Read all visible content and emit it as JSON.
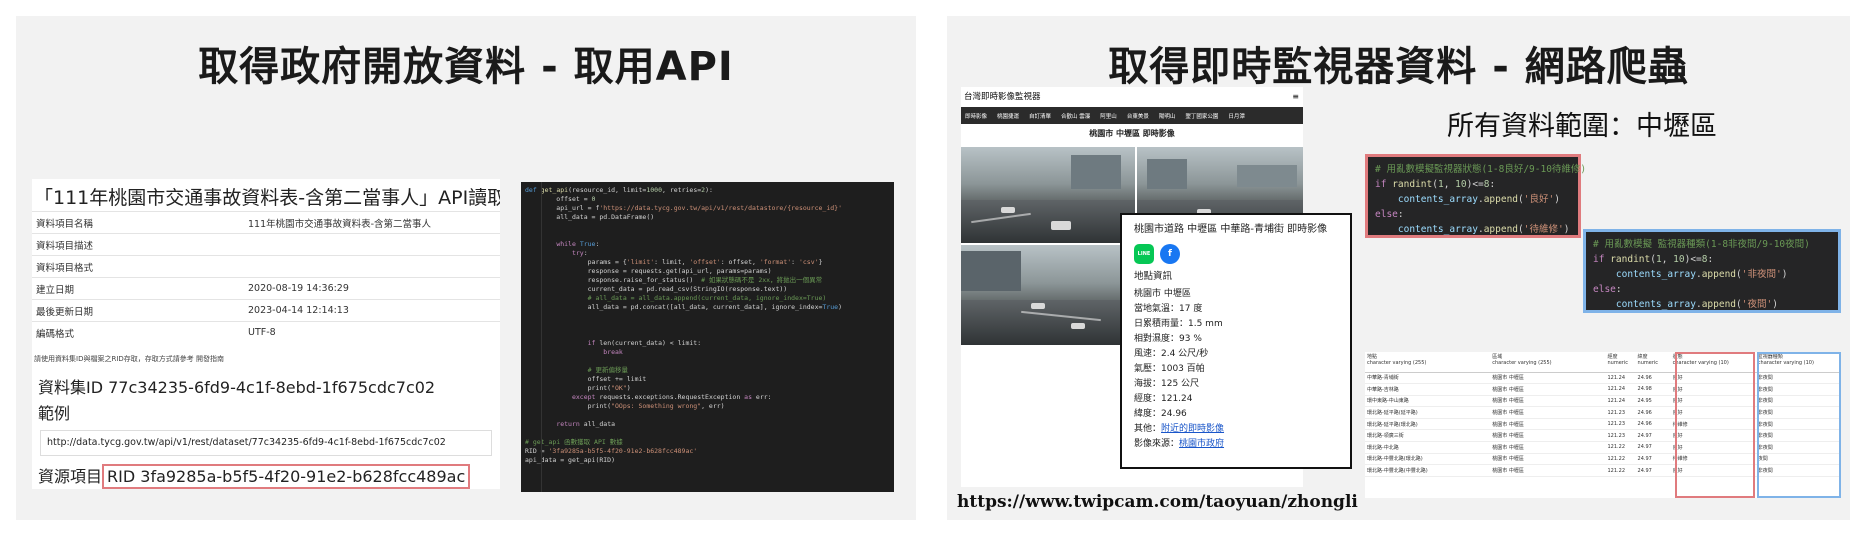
{
  "left": {
    "title": "取得政府開放資料 - 取用API",
    "api_heading": "「111年桃園市交通事故資料表-含第二當事人」API讀取",
    "meta_rows": [
      {
        "key": "資料項目名稱",
        "value": "111年桃園市交通事故資料表-含第二當事人"
      },
      {
        "key": "資料項目描述",
        "value": ""
      },
      {
        "key": "資料項目格式",
        "value": ""
      },
      {
        "key": "建立日期",
        "value": "2020-08-19 14:36:29"
      },
      {
        "key": "最後更新日期",
        "value": "2023-04-14 12:14:13"
      },
      {
        "key": "編碼格式",
        "value": "UTF-8"
      }
    ],
    "note": "請使用資料集ID與檔案之RID存取，存取方式請參考 開發指南",
    "dataset_id": "資料集ID 77c34235-6fd9-4c1f-8ebd-1f675cdc7c02",
    "example_label": "範例",
    "example_url": "http://data.tycg.gov.tw/api/v1/rest/dataset/77c34235-6fd9-4c1f-8ebd-1f675cdc7c02",
    "rid_label": "資源項目",
    "rid_value": "RID 3fa9285a-b5f5-4f20-91e2-b628fcc489ac"
  },
  "right": {
    "title": "取得即時監視器資料 - 網路爬蟲",
    "scope_label": "所有資料範圍：中壢區",
    "site_title": "台灣即時影像監視器",
    "menu_icon": "≡",
    "nav_items": [
      "即時影像",
      "桃園捷運",
      "自訂清單",
      "合歡山 雲瀑",
      "阿里山",
      "台東美景",
      "陽明山",
      "墾丁國家公園",
      "日月潭"
    ],
    "cam_heading": "桃園市 中壢區 即時影像",
    "popup": {
      "title": "桃園市道路 中壢區 中華路-青埔街 即時影像",
      "line_icon": "LINE",
      "facebook_icon": "f",
      "section": "地點資訊",
      "lines": [
        "桃園市 中壢區",
        "當地氣溫：17 度",
        "日累積雨量：1.5 mm",
        "相對濕度：93 %",
        "風速：2.4 公尺/秒",
        "氣壓：1003 百帕",
        "海拔：125 公尺",
        "經度：121.24",
        "緯度：24.96"
      ],
      "nearby_label": "其他：",
      "nearby_link": "附近的即時影像",
      "source_label": "影像來源：",
      "source_link": "桃園市政府"
    },
    "code1": {
      "comment": "# 用亂數模擬監視器狀態(1-8良好/9-10待維修)",
      "good": "'良好'",
      "repair": "'待維修'"
    },
    "code2": {
      "comment": "# 用亂數模擬 監視器種類(1-8非夜間/9-10夜間)",
      "nonnight": "'非夜間'",
      "night": "'夜間'"
    },
    "site_url": "https://www.twipcam.com/taoyuan/zhongli",
    "table": {
      "headers": [
        {
          "name": "地點",
          "type": "character varying (255)"
        },
        {
          "name": "區域",
          "type": "character varying (255)"
        },
        {
          "name": "經度",
          "type": "numeric"
        },
        {
          "name": "緯度",
          "type": "numeric"
        },
        {
          "name": "狀態",
          "type": "character varying (10)"
        },
        {
          "name": "監視器種類",
          "type": "character varying (10)"
        }
      ],
      "rows": [
        [
          "中華路-青埔街",
          "桃園市 中壢區",
          "121.24",
          "24.96",
          "良好",
          "非夜間"
        ],
        [
          "中華路-吉林路",
          "桃園市 中壢區",
          "121.24",
          "24.98",
          "良好",
          "非夜間"
        ],
        [
          "環中東路-中山東路",
          "桃園市 中壢區",
          "121.24",
          "24.95",
          "良好",
          "非夜間"
        ],
        [
          "環北路-延平路(延平路)",
          "桃園市 中壢區",
          "121.23",
          "24.96",
          "良好",
          "非夜間"
        ],
        [
          "環北路-延平路(環北路)",
          "桃園市 中壢區",
          "121.23",
          "24.96",
          "待維修",
          "非夜間"
        ],
        [
          "環北路-領廣三街",
          "桃園市 中壢區",
          "121.23",
          "24.97",
          "良好",
          "非夜間"
        ],
        [
          "環北路-中北路",
          "桃園市 中壢區",
          "121.22",
          "24.97",
          "良好",
          "非夜間"
        ],
        [
          "環北路-中豐北路(環北路)",
          "桃園市 中壢區",
          "121.22",
          "24.97",
          "待維修",
          "夜間"
        ],
        [
          "環北路-中豐北路(中豐北路)",
          "桃園市 中壢區",
          "121.22",
          "24.97",
          "良好",
          "非夜間"
        ]
      ]
    }
  }
}
